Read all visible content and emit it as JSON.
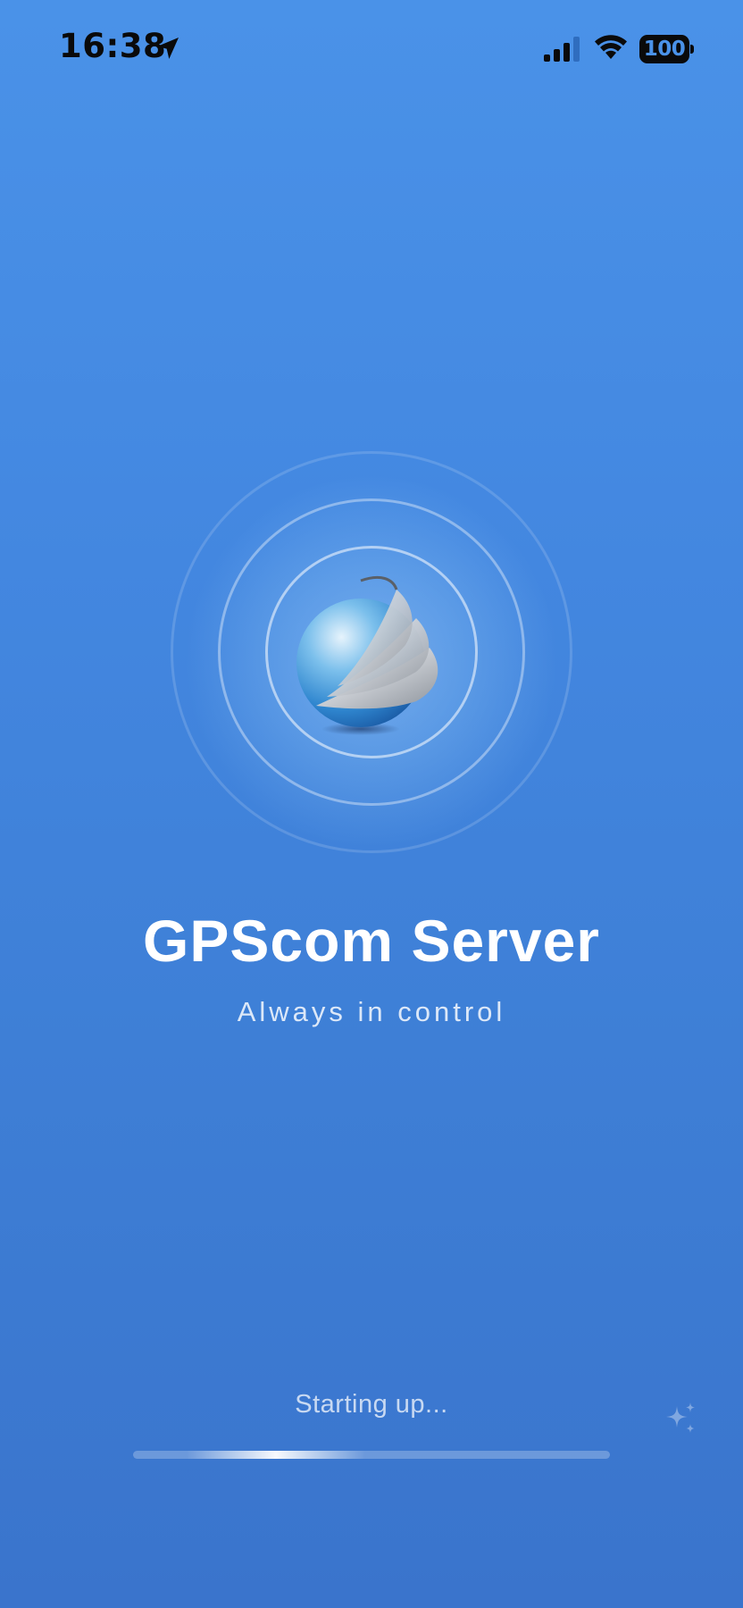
{
  "status_bar": {
    "time": "16:38",
    "battery_level": "100",
    "icons": [
      "location-arrow-icon",
      "cellular-signal-icon",
      "wifi-icon",
      "battery-icon"
    ]
  },
  "splash": {
    "logo_icon": "globe-swoosh-logo",
    "title": "GPScom Server",
    "subtitle": "Always in control",
    "status": "Starting up...",
    "corner_icon": "sparkle-icon"
  },
  "colors": {
    "background_top": "#4a92e8",
    "background_bottom": "#3a74cc",
    "text_primary": "#ffffff",
    "status_bar_text": "#0a0a0a"
  }
}
